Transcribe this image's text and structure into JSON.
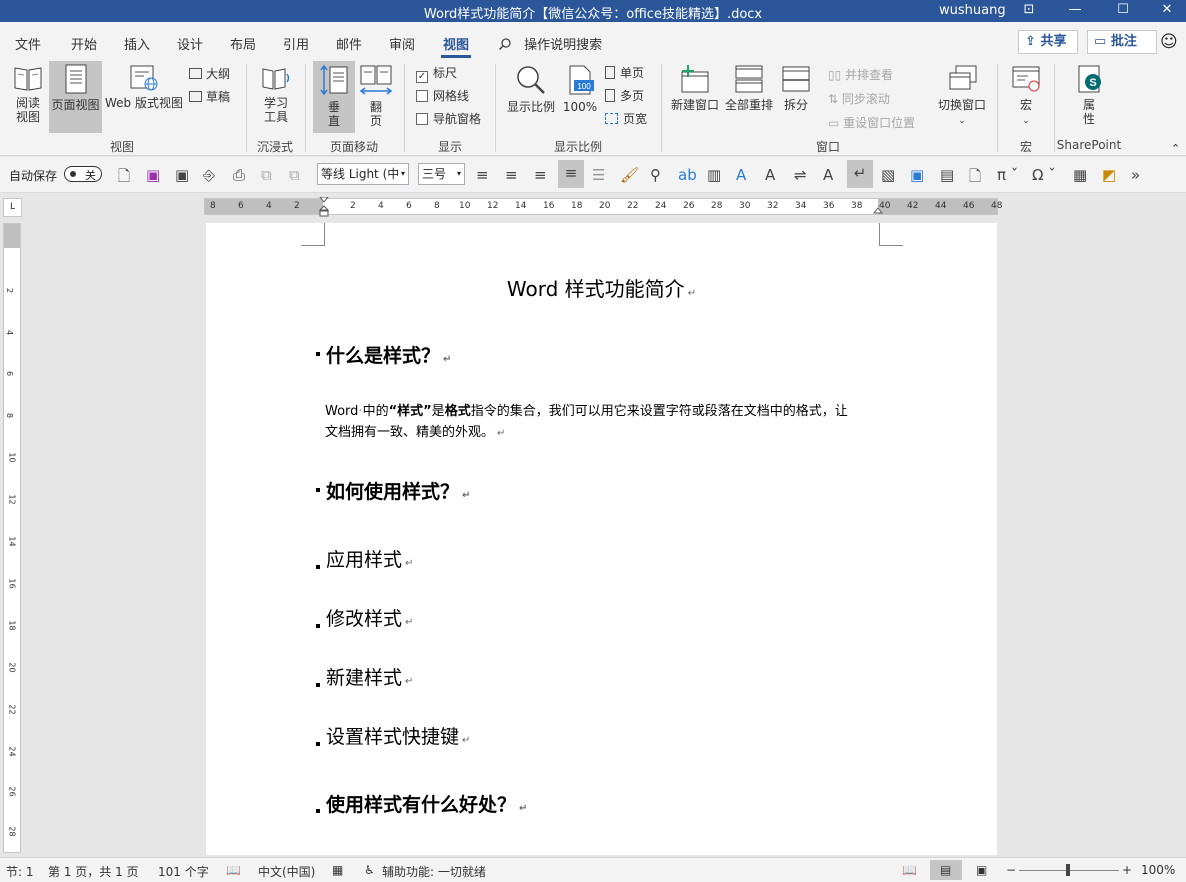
{
  "window": {
    "title": "Word样式功能简介【微信公众号：office技能精选】.docx",
    "user": "wushuang",
    "controls": [
      "⊡",
      "—",
      "☐",
      "✕"
    ]
  },
  "menu": {
    "tabs": [
      "文件",
      "开始",
      "插入",
      "设计",
      "布局",
      "引用",
      "邮件",
      "审阅",
      "视图"
    ],
    "active": "视图",
    "tell_me": "操作说明搜索",
    "share": "共享",
    "comment": "批注"
  },
  "ribbon": {
    "groups": {
      "views": "视图",
      "immersive": "沉浸式",
      "page_move": "页面移动",
      "show": "显示",
      "zoom": "显示比例",
      "window": "窗口",
      "macros": "宏",
      "sharepoint": "SharePoint"
    },
    "buttons": {
      "read_mode_1": "阅读",
      "read_mode_2": "视图",
      "print_layout": "页面视图",
      "web_layout": "Web 版式视图",
      "outline": "大纲",
      "draft": "草稿",
      "learning_1": "学习",
      "learning_2": "工具",
      "vertical_1": "垂",
      "vertical_2": "直",
      "side_1": "翻",
      "side_2": "页",
      "ruler": "标尺",
      "gridlines": "网格线",
      "nav_pane": "导航窗格",
      "zoom": "显示比例",
      "hundred": "100%",
      "one_page": "单页",
      "multi_page": "多页",
      "page_width": "页宽",
      "new_window": "新建窗口",
      "arrange_all": "全部重排",
      "split": "拆分",
      "side_by_side": "并排查看",
      "sync_scroll": "同步滚动",
      "reset_pos": "重设窗口位置",
      "switch_window": "切换窗口",
      "macros": "宏",
      "properties_1": "属",
      "properties_2": "性"
    },
    "checked": {
      "ruler": true,
      "gridlines": false,
      "nav_pane": false
    }
  },
  "qat": {
    "autosave": "自动保存",
    "autosave_state": "关",
    "font": "等线 Light (中",
    "size": "三号"
  },
  "ruler": {
    "h_ticks": [
      "8",
      "6",
      "4",
      "2",
      "2",
      "4",
      "6",
      "8",
      "10",
      "12",
      "14",
      "16",
      "18",
      "20",
      "22",
      "24",
      "26",
      "28",
      "30",
      "32",
      "34",
      "36",
      "38",
      "40",
      "42",
      "44",
      "46",
      "48"
    ],
    "v_ticks": [
      "2",
      "4",
      "6",
      "8",
      "10",
      "12",
      "14",
      "16",
      "18",
      "20",
      "22",
      "24",
      "26",
      "28"
    ]
  },
  "document": {
    "title": "Word 样式功能简介",
    "h_what": "什么是样式？",
    "para_1a": "Word",
    "para_1b": "中的",
    "para_1c": "“样式”",
    "para_1d": "是",
    "para_1e": "格式",
    "para_1f": "指令的集合，我们可以用它来设置字符或段落在文档中的格式，让",
    "para_2": "文档拥有一致、精美的外观。",
    "h_how": "如何使用样式？",
    "sub_apply": "应用样式",
    "sub_modify": "修改样式",
    "sub_new": "新建样式",
    "sub_shortcut": "设置样式快捷键",
    "h_benefit": "使用样式有什么好处？",
    "para_mark": "↵"
  },
  "status": {
    "section": "节: 1",
    "page": "第 1 页，共 1 页",
    "words": "101 个字",
    "lang": "中文(中国)",
    "accessibility": "辅助功能: 一切就绪",
    "zoom": "100%"
  }
}
